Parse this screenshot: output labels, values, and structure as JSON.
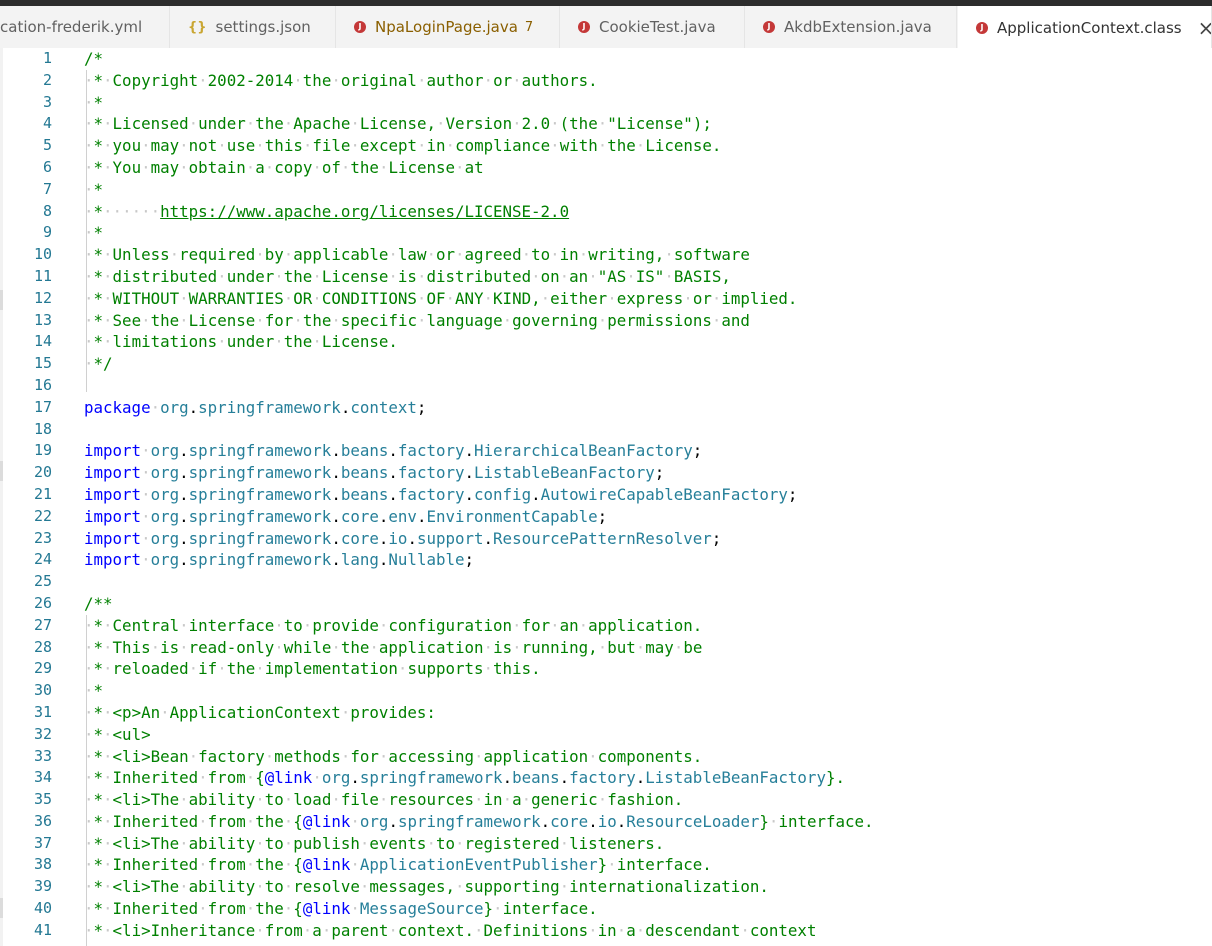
{
  "tabs": [
    {
      "label": "cation-frederik.yml",
      "icon": "yaml-file-icon",
      "active": false
    },
    {
      "label": "settings.json",
      "icon": "json-file-icon",
      "active": false
    },
    {
      "label": "NpaLoginPage.java",
      "icon": "java-file-icon",
      "badge": "7",
      "active": false,
      "modified": true
    },
    {
      "label": "CookieTest.java",
      "icon": "java-file-icon",
      "active": false
    },
    {
      "label": "AkdbExtension.java",
      "icon": "java-file-icon",
      "active": false
    },
    {
      "label": "ApplicationContext.class",
      "icon": "java-file-icon",
      "active": true
    }
  ],
  "colors": {
    "comment": "#008000",
    "keyword": "#0000ff",
    "type": "#267f99",
    "line_number": "#237893",
    "java_icon": "#c43838",
    "json_icon": "#c9a632"
  },
  "editor": {
    "lines": [
      {
        "n": "1",
        "t": "/*"
      },
      {
        "n": "2",
        "t": " * Copyright 2002-2014 the original author or authors."
      },
      {
        "n": "3",
        "t": " *"
      },
      {
        "n": "4",
        "t": " * Licensed under the Apache License, Version 2.0 (the \"License\");"
      },
      {
        "n": "5",
        "t": " * you may not use this file except in compliance with the License."
      },
      {
        "n": "6",
        "t": " * You may obtain a copy of the License at"
      },
      {
        "n": "7",
        "t": " *"
      },
      {
        "n": "8",
        "t": " *      https://www.apache.org/licenses/LICENSE-2.0"
      },
      {
        "n": "9",
        "t": " *"
      },
      {
        "n": "10",
        "t": " * Unless required by applicable law or agreed to in writing, software"
      },
      {
        "n": "11",
        "t": " * distributed under the License is distributed on an \"AS IS\" BASIS,"
      },
      {
        "n": "12",
        "t": " * WITHOUT WARRANTIES OR CONDITIONS OF ANY KIND, either express or implied."
      },
      {
        "n": "13",
        "t": " * See the License for the specific language governing permissions and"
      },
      {
        "n": "14",
        "t": " * limitations under the License."
      },
      {
        "n": "15",
        "t": " */"
      },
      {
        "n": "16",
        "t": ""
      },
      {
        "n": "17",
        "t": "package org.springframework.context;"
      },
      {
        "n": "18",
        "t": ""
      },
      {
        "n": "19",
        "t": "import org.springframework.beans.factory.HierarchicalBeanFactory;"
      },
      {
        "n": "20",
        "t": "import org.springframework.beans.factory.ListableBeanFactory;"
      },
      {
        "n": "21",
        "t": "import org.springframework.beans.factory.config.AutowireCapableBeanFactory;"
      },
      {
        "n": "22",
        "t": "import org.springframework.core.env.EnvironmentCapable;"
      },
      {
        "n": "23",
        "t": "import org.springframework.core.io.support.ResourcePatternResolver;"
      },
      {
        "n": "24",
        "t": "import org.springframework.lang.Nullable;"
      },
      {
        "n": "25",
        "t": ""
      },
      {
        "n": "26",
        "t": "/**"
      },
      {
        "n": "27",
        "t": " * Central interface to provide configuration for an application."
      },
      {
        "n": "28",
        "t": " * This is read-only while the application is running, but may be"
      },
      {
        "n": "29",
        "t": " * reloaded if the implementation supports this."
      },
      {
        "n": "30",
        "t": " *"
      },
      {
        "n": "31",
        "t": " * <p>An ApplicationContext provides:"
      },
      {
        "n": "32",
        "t": " * <ul>"
      },
      {
        "n": "33",
        "t": " * <li>Bean factory methods for accessing application components."
      },
      {
        "n": "34",
        "t": " * Inherited from {@link org.springframework.beans.factory.ListableBeanFactory}."
      },
      {
        "n": "35",
        "t": " * <li>The ability to load file resources in a generic fashion."
      },
      {
        "n": "36",
        "t": " * Inherited from the {@link org.springframework.core.io.ResourceLoader} interface."
      },
      {
        "n": "37",
        "t": " * <li>The ability to publish events to registered listeners."
      },
      {
        "n": "38",
        "t": " * Inherited from the {@link ApplicationEventPublisher} interface."
      },
      {
        "n": "39",
        "t": " * <li>The ability to resolve messages, supporting internationalization."
      },
      {
        "n": "40",
        "t": " * Inherited from the {@link MessageSource} interface."
      },
      {
        "n": "41",
        "t": " * <li>Inheritance from a parent context. Definitions in a descendant context"
      }
    ]
  }
}
